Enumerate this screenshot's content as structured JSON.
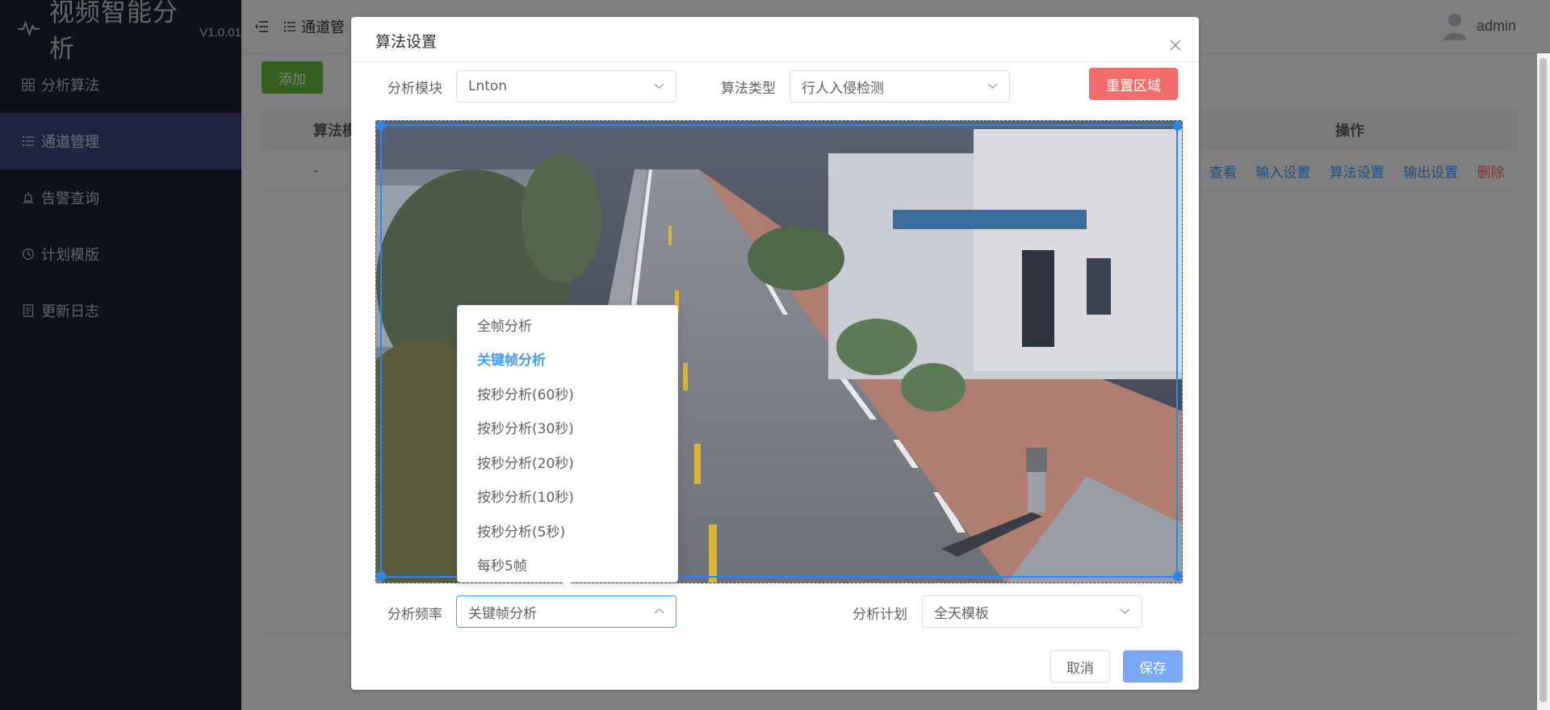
{
  "app": {
    "title": "视频智能分析",
    "version": "V1.0.01"
  },
  "sidebar": {
    "items": [
      {
        "label": "分析算法",
        "icon": "grid-icon",
        "active": false
      },
      {
        "label": "通道管理",
        "icon": "list-icon",
        "active": true
      },
      {
        "label": "告警查询",
        "icon": "alarm-icon",
        "active": false
      },
      {
        "label": "计划模版",
        "icon": "clock-icon",
        "active": false
      },
      {
        "label": "更新日志",
        "icon": "document-icon",
        "active": false
      }
    ]
  },
  "header": {
    "breadcrumb": "通道管",
    "user": "admin"
  },
  "main": {
    "add_label": "添加",
    "table": {
      "headers": [
        "算法模",
        "操作"
      ],
      "row": {
        "col1": "-",
        "ops": [
          "查看",
          "输入设置",
          "算法设置",
          "输出设置",
          "删除"
        ]
      }
    }
  },
  "dialog": {
    "title": "算法设置",
    "module_label": "分析模块",
    "module_value": "Lnton",
    "algo_type_label": "算法类型",
    "algo_type_value": "行人入侵检测",
    "reset_label": "重置区域",
    "freq_label": "分析频率",
    "freq_value": "关键帧分析",
    "plan_label": "分析计划",
    "plan_value": "全天模板",
    "cancel_label": "取消",
    "save_label": "保存",
    "freq_options": [
      "全帧分析",
      "关键帧分析",
      "按秒分析(60秒)",
      "按秒分析(30秒)",
      "按秒分析(20秒)",
      "按秒分析(10秒)",
      "按秒分析(5秒)",
      "每秒5帧"
    ],
    "selected_option": "关键帧分析"
  },
  "colors": {
    "sidebar_bg": "#1d2330",
    "sidebar_active": "#3a4a7e",
    "primary": "#409eff",
    "danger": "#f56c6c",
    "success": "#67c23a",
    "roi": "#2f86ea"
  }
}
